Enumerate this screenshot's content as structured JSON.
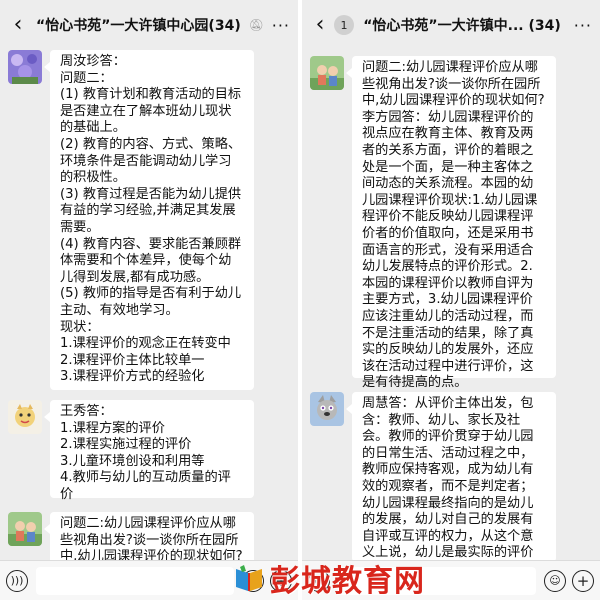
{
  "left": {
    "header": {
      "back_icon": "‹",
      "title": "“怡心书苑”一大许镇中心园(34)"
    },
    "messages": [
      {
        "avatar_icon": "avatar-purple-flowers",
        "text": "周汝珍答：\n问题二：\n(1) 教育计划和教育活动的目标是否建立在了解本班幼儿现状的基础上。\n(2) 教育的内容、方式、策略、环境条件是否能调动幼儿学习的积极性。\n(3) 教育过程是否能为幼儿提供有益的学习经验,并满足其发展需要。\n(4) 教育内容、要求能否兼顾群体需要和个体差异，使每个幼儿得到发展,都有成功感。\n(5) 教师的指导是否有利于幼儿主动、有效地学习。\n现状：\n1.课程评价的观念正在转变中\n2.课程评价主体比较单一\n3.课程评价方式的经验化"
      },
      {
        "avatar_icon": "avatar-cartoon-cat",
        "text": "王秀答：\n1.课程方案的评价\n2.课程实施过程的评价\n3.儿童环境创设和利用等\n4.教师与幼儿的互动质量的评价"
      },
      {
        "avatar_icon": "avatar-child-green",
        "text": "问题二:幼儿园课程评价应从哪些视角出发?谈一谈你所在园所中,幼儿园课程评价的现状如何?"
      }
    ]
  },
  "right": {
    "header": {
      "back_icon": "‹",
      "badge": "1",
      "title": "“怡心书苑”一大许镇中...  (34)"
    },
    "messages": [
      {
        "avatar_icon": "avatar-child-green",
        "text": "问题二:幼儿园课程评价应从哪些视角出发?谈一谈你所在园所中,幼儿园课程评价的现状如何?\n李方园答：幼儿园课程评价的视点应在教育主体、教育及两者的关系方面，评价的着眼之处是一个面，是一种主客体之间动态的关系流程。本园的幼儿园课程评价现状:1.幼儿园课程评价不能反映幼儿园课程评价者的价值取向，还是采用书面语言的形式，没有采用适合幼儿发展特点的评价形式。2.本园的课程评价以教师自评为主要方式，3.幼儿园课程评价应该注重幼儿的活动过程，而不是注重活动的结果，除了真实的反映幼儿的发展外，还应该在活动过程中进行评价，这是有待提高的点。"
      },
      {
        "avatar_icon": "avatar-cartoon-fox",
        "text": "周慧答：从评价主体出发，包含：教师、幼儿、家长及社会。教师的评价贯穿于幼儿园的日常生活、活动过程之中，教师应保持客观，成为幼儿有效的观察者，而不是判定者；幼儿园课程最终指向的是幼儿的发展，幼儿对自己的发展有自评或互评的权力，从这个意义上说，幼儿是最实际的评价主体，幼儿的发展是"
      }
    ]
  },
  "watermark": {
    "text": "彭城教育网"
  }
}
